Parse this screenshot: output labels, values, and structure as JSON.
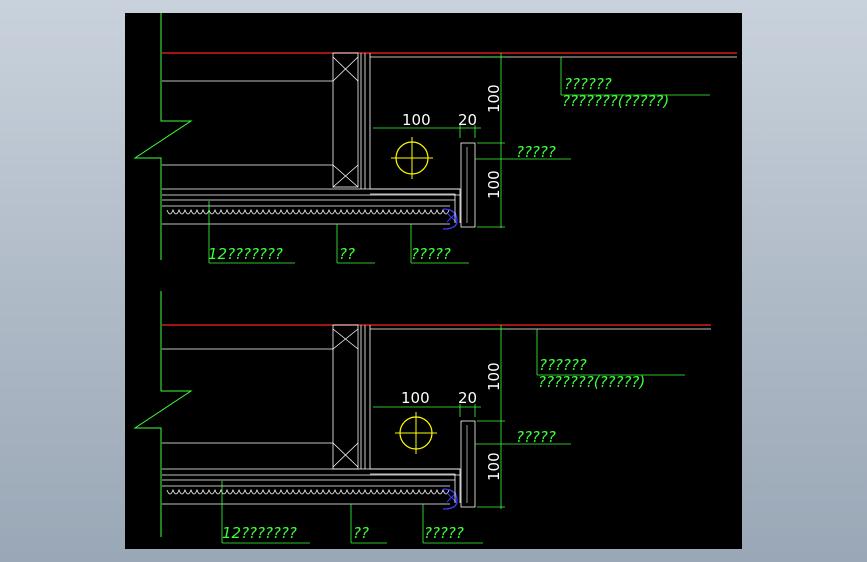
{
  "viewport": {
    "background": "#b6c0cc",
    "canvas_background": "#000000"
  },
  "colors": {
    "dim": "#3cff3c",
    "line": "#ffffff",
    "red": "#ff2020",
    "yellow": "#ffff00",
    "blue": "#3b3bff"
  },
  "details": [
    {
      "dim_100_horizontal": "100",
      "dim_20": "20",
      "dim_100_upper": "100",
      "dim_100_lower": "100",
      "note_ceiling_a": "??????",
      "note_ceiling_b": "???????(?????)",
      "note_side": "?????",
      "note_board": "12???????",
      "note_mid": "??",
      "note_trim": "?????"
    },
    {
      "dim_100_horizontal": "100",
      "dim_20": "20",
      "dim_100_upper": "100",
      "dim_100_lower": "100",
      "note_ceiling_a": "??????",
      "note_ceiling_b": "???????(?????)",
      "note_side": "?????",
      "note_board": "12???????",
      "note_mid": "??",
      "note_trim": "?????"
    }
  ]
}
